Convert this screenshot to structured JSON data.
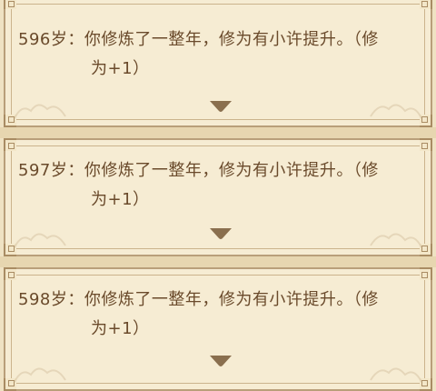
{
  "colors": {
    "background": "#efe2c3",
    "card_bg": "#f6ecd3",
    "frame": "#b99f7a",
    "text": "#6a4a2b",
    "arrow": "#8a6f4e"
  },
  "log": [
    {
      "age": "596岁：",
      "text_line1": "你修炼了一整年，修为有小许提升。（修",
      "text_line2": "为+1）",
      "icon": "chevron-down-icon"
    },
    {
      "age": "597岁：",
      "text_line1": "你修炼了一整年，修为有小许提升。（修",
      "text_line2": "为+1）",
      "icon": "chevron-down-icon"
    },
    {
      "age": "598岁：",
      "text_line1": "你修炼了一整年，修为有小许提升。（修",
      "text_line2": "为+1）",
      "icon": "chevron-down-icon"
    }
  ]
}
